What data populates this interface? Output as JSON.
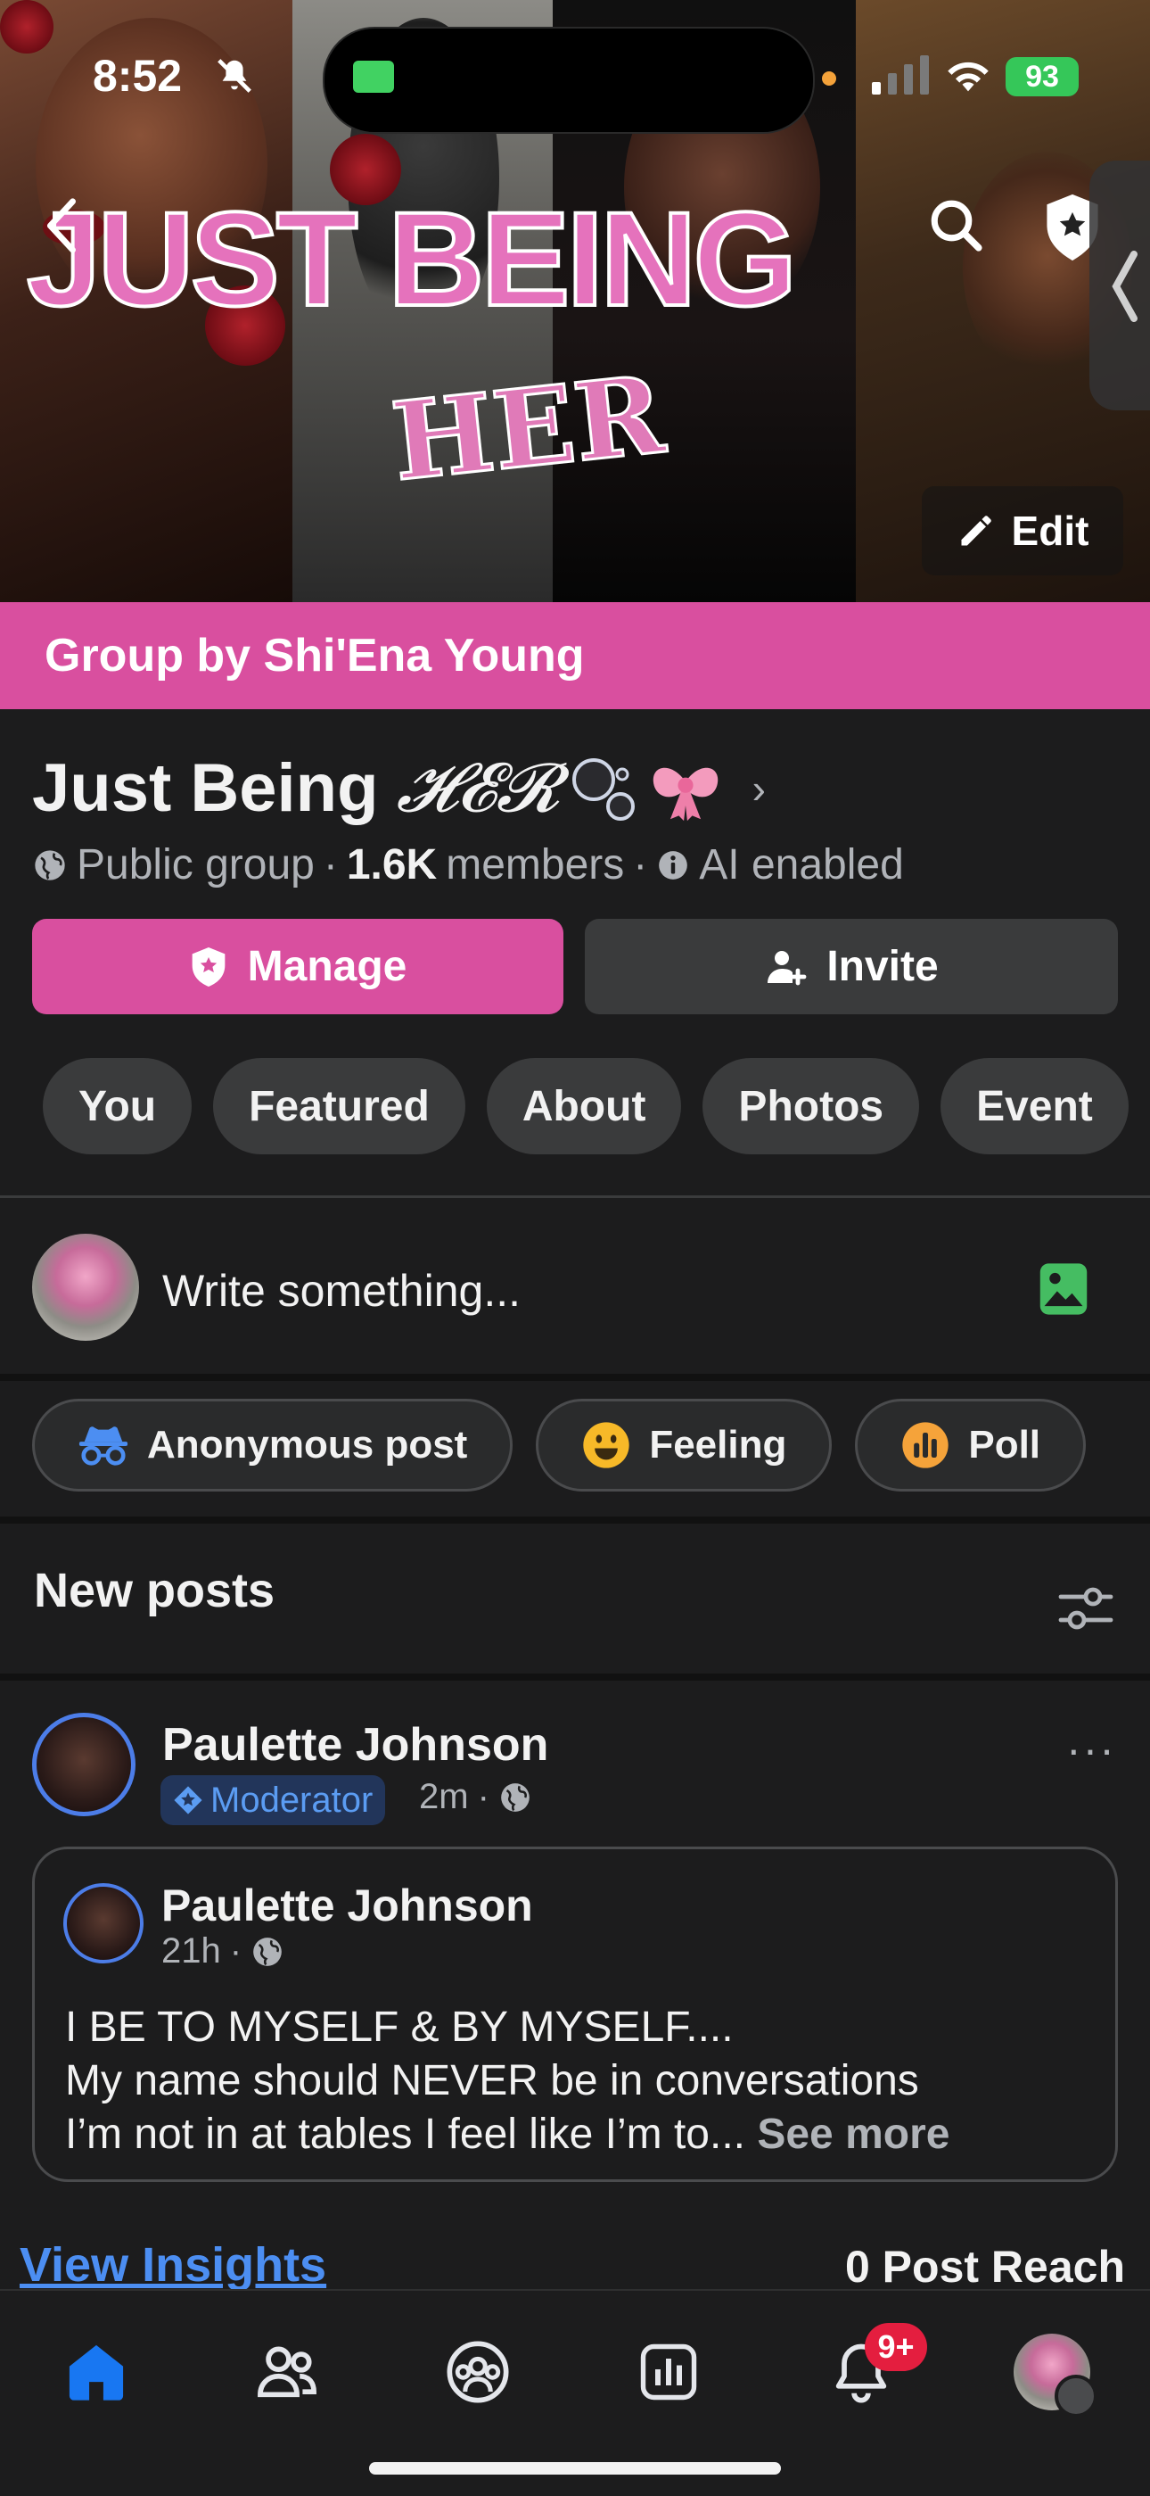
{
  "status_bar": {
    "time": "8:52",
    "battery": "93"
  },
  "cover": {
    "title_art_line1": "JUST BEING",
    "title_art_line2": "HER",
    "edit_label": "Edit"
  },
  "group_band": {
    "text": "Group by Shi'Ena Young"
  },
  "group": {
    "name": "Just Being",
    "name_script": "𝓗𝓔𝓡",
    "privacy": "Public group",
    "member_count": "1.6K",
    "members_label": "members",
    "ai_label": "AI enabled",
    "separator": "·"
  },
  "actions": {
    "manage_label": "Manage",
    "invite_label": "Invite"
  },
  "tabs": [
    {
      "label": "You"
    },
    {
      "label": "Featured"
    },
    {
      "label": "About"
    },
    {
      "label": "Photos"
    },
    {
      "label": "Event"
    }
  ],
  "composer": {
    "placeholder": "Write something..."
  },
  "chips": [
    {
      "label": "Anonymous post",
      "icon": "incognito-icon"
    },
    {
      "label": "Feeling",
      "icon": "smiley-icon"
    },
    {
      "label": "Poll",
      "icon": "poll-icon"
    }
  ],
  "feed": {
    "section_title": "New posts"
  },
  "post": {
    "author": "Paulette Johnson",
    "role": "Moderator",
    "time": "2m",
    "more": "···",
    "shared": {
      "author": "Paulette Johnson",
      "time": "21h",
      "line1": "I BE TO MYSELF & BY MYSELF....",
      "line2": "My name should NEVER be in conversations",
      "line3": "I’m not in at tables I feel like I’m to...",
      "see_more": "See more"
    },
    "insights_link": "View Insights",
    "reach": "0 Post Reach"
  },
  "bottom_nav": {
    "notifications_badge": "9+",
    "items": [
      "home-icon",
      "friends-icon",
      "groups-icon",
      "insights-icon",
      "bell-icon",
      "profile-avatar"
    ]
  },
  "colors": {
    "accent_pink": "#d94f9f",
    "background": "#1c1c1d",
    "link_blue": "#4c8ef2",
    "badge_red": "#e41e3f"
  }
}
